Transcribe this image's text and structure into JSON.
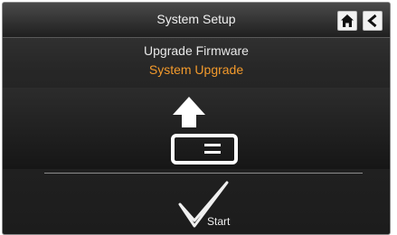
{
  "header": {
    "title": "System Setup",
    "home_icon": "home-icon",
    "back_icon": "back-arrow-icon"
  },
  "main": {
    "subtitle": "Upgrade Firmware",
    "selected_item": "System Upgrade",
    "illustration_icon": "upgrade-device-icon"
  },
  "action": {
    "icon": "checkmark-icon",
    "label": "Start"
  },
  "colors": {
    "accent": "#f39a2c",
    "text": "#f0f0f0",
    "background": "#1c1c1c"
  }
}
